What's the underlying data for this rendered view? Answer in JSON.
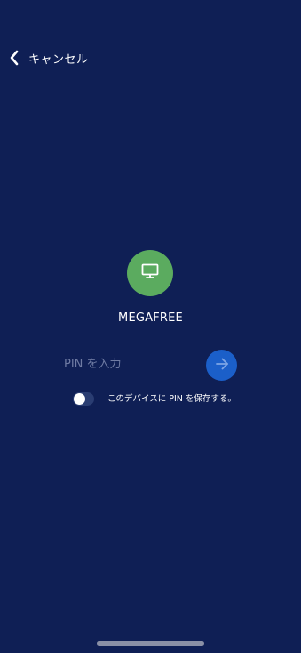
{
  "header": {
    "back_icon": "chevron-left",
    "cancel_label": "キャンセル"
  },
  "device": {
    "icon": "monitor-icon",
    "icon_bg": "#5bab5f",
    "name": "MEGAFREE"
  },
  "pin": {
    "placeholder": "PIN を入力",
    "value": "",
    "submit_icon": "arrow-right-icon",
    "submit_bg": "#1b5fc9"
  },
  "save_pin": {
    "enabled": false,
    "label": "このデバイスに PIN を保存する。"
  },
  "theme": {
    "background": "#0f1f55"
  }
}
